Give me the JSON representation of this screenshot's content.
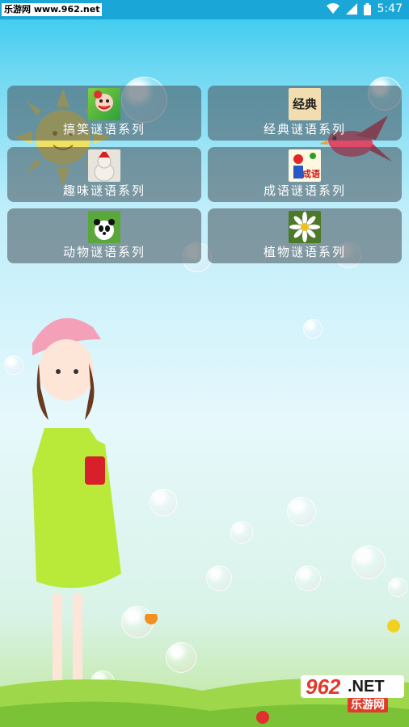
{
  "status_bar": {
    "watermark": "乐游网 www.962.net",
    "time": "5:47"
  },
  "categories": [
    {
      "label": "搞笑谜语系列",
      "icon": "funny-cartoon-icon"
    },
    {
      "label": "经典谜语系列",
      "icon": "classic-icon",
      "icon_text": "经典"
    },
    {
      "label": "趣味谜语系列",
      "icon": "santa-dog-icon"
    },
    {
      "label": "成语谜语系列",
      "icon": "idiom-icon",
      "icon_text": "成语"
    },
    {
      "label": "动物谜语系列",
      "icon": "panda-icon"
    },
    {
      "label": "植物谜语系列",
      "icon": "daisy-icon"
    }
  ],
  "brand_logo": {
    "number": "962",
    "suffix": ".NET",
    "name": "乐游网"
  },
  "colors": {
    "status_bar": "#1aa6d6",
    "card_bg": "rgba(70,80,90,0.55)",
    "logo_red": "#e23a2a"
  }
}
